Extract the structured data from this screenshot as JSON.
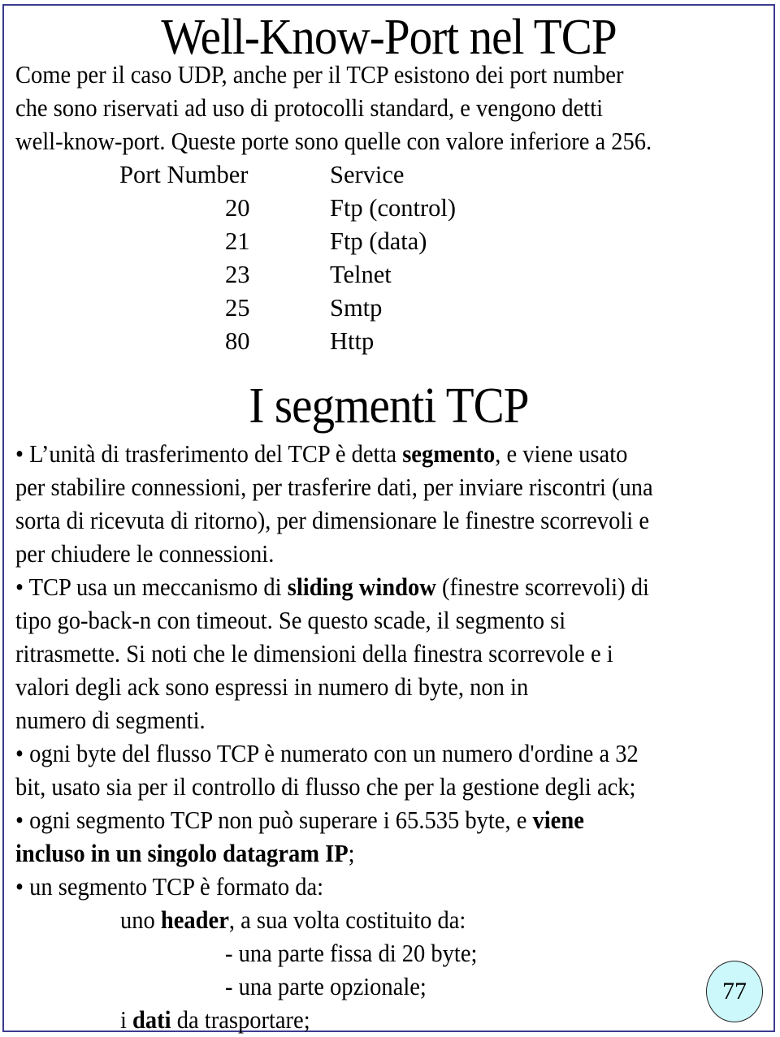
{
  "slide": {
    "border_color": "#3b3b8f",
    "title_top": "Well-Know-Port nel TCP",
    "intro_lines": [
      "Come per il caso UDP, anche per il TCP esistono dei port number",
      "che sono riservati ad uso di protocolli standard, e vengono detti",
      "well-know-port. Queste porte sono quelle con valore inferiore a 256."
    ],
    "port_table": {
      "headers": {
        "port": "Port Number",
        "service": "Service"
      },
      "rows": [
        {
          "port": "20",
          "service": "Ftp (control)"
        },
        {
          "port": "21",
          "service": "Ftp (data)"
        },
        {
          "port": "23",
          "service": "Telnet"
        },
        {
          "port": "25",
          "service": "Smtp"
        },
        {
          "port": "80",
          "service": "Http"
        }
      ]
    },
    "title_bottom": "I segmenti TCP",
    "bullet1": {
      "l1_pre": "• L’unità di trasferimento del TCP è detta ",
      "l1_bold": "segmento",
      "l1_post": ", e viene usato",
      "l2": "per stabilire connessioni, per trasferire dati, per inviare riscontri (una",
      "l3": "sorta di ricevuta di ritorno), per dimensionare le finestre scorrevoli e",
      "l4": "per chiudere le connessioni."
    },
    "bullet2": {
      "l1_pre": "• TCP usa un meccanismo di ",
      "l1_bold": "sliding window",
      "l1_post": " (finestre scorrevoli) di",
      "l2": "tipo go-back-n con timeout. Se questo scade, il segmento si",
      "l3": "ritrasmette. Si noti che le dimensioni della finestra scorrevole e i",
      "l4": "valori degli ack sono espressi in numero di byte, non in",
      "l5": "numero di segmenti."
    },
    "bullet3": {
      "l1": "• ogni byte del flusso TCP è numerato con un numero d'ordine a 32",
      "l2": "bit, usato sia per il controllo di flusso che per la gestione degli ack;"
    },
    "bullet4": {
      "l1_pre": "• ogni segmento TCP non può superare i 65.535 byte, e ",
      "l1_bold": "viene",
      "l2_bold": "incluso in un singolo datagram IP",
      "l2_post": ";"
    },
    "bullet5": {
      "l1": "• un segmento TCP è formato da:",
      "l2_pre": "uno ",
      "l2_bold": "header",
      "l2_post": ", a sua volta costituito da:",
      "l3": "- una parte fissa di 20 byte;",
      "l4": "- una parte opzionale;",
      "l5_pre": "i ",
      "l5_bold": "dati",
      "l5_post": " da trasportare;"
    },
    "page_number": "77",
    "badge_color": "#ccf8fb"
  }
}
